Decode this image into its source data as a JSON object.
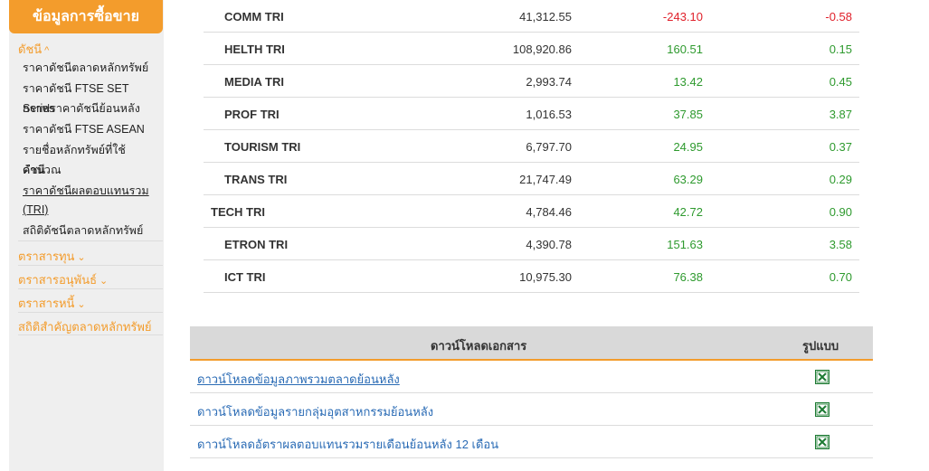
{
  "sidebar": {
    "header": "ข้อมูลการซื้อขาย",
    "section_index": "ดัชนี",
    "index_items": [
      "ราคาดัชนีตลาดหลักทรัพย์",
      "ราคาดัชนี FTSE SET Series",
      "กราฟราคาดัชนีย้อนหลัง",
      "ราคาดัชนี FTSE ASEAN",
      "รายชื่อหลักทรัพย์ที่ใช้คำนวณ",
      "ดัชนี",
      "ราคาดัชนีผลตอบแทนรวม",
      "(TRI)",
      "สถิติดัชนีตลาดหลักทรัพย์"
    ],
    "sections": [
      "ตราสารทุน",
      "ตราสารอนุพันธ์",
      "ตราสารหนี้",
      "สถิติสำคัญตลาดหลักทรัพย์"
    ]
  },
  "index_rows": [
    {
      "name": "COMM TRI",
      "value": "41,312.55",
      "change": "-243.10",
      "pct": "-0.58"
    },
    {
      "name": "HELTH TRI",
      "value": "108,920.86",
      "change": "160.51",
      "pct": "0.15"
    },
    {
      "name": "MEDIA TRI",
      "value": "2,993.74",
      "change": "13.42",
      "pct": "0.45"
    },
    {
      "name": "PROF TRI",
      "value": "1,016.53",
      "change": "37.85",
      "pct": "3.87"
    },
    {
      "name": "TOURISM TRI",
      "value": "6,797.70",
      "change": "24.95",
      "pct": "0.37"
    },
    {
      "name": "TRANS TRI",
      "value": "21,747.49",
      "change": "63.29",
      "pct": "0.29"
    },
    {
      "name": "TECH TRI",
      "value": "4,784.46",
      "change": "42.72",
      "pct": "0.90"
    },
    {
      "name": "ETRON TRI",
      "value": "4,390.78",
      "change": "151.63",
      "pct": "3.58"
    },
    {
      "name": "ICT TRI",
      "value": "10,975.30",
      "change": "76.38",
      "pct": "0.70"
    }
  ],
  "downloads": {
    "header_doc": "ดาวน์โหลดเอกสาร",
    "header_format": "รูปแบบ",
    "rows": [
      "ดาวน์โหลดข้อมูลภาพรวมตลาดย้อนหลัง",
      "ดาวน์โหลดข้อมูลรายกลุ่มอุตสาหกรรมย้อนหลัง",
      "ดาวน์โหลดอัตราผลตอบแทนรวมรายเดือนย้อนหลัง 12 เดือน"
    ]
  },
  "colors": {
    "accent": "#f39c2c",
    "positive": "#2e9a2e",
    "negative": "#e0202a",
    "link": "#2a6bb5"
  },
  "icons": {
    "section_open": "chevron-up-icon",
    "section_closed": "chevron-down-icon",
    "file": "excel-icon"
  }
}
